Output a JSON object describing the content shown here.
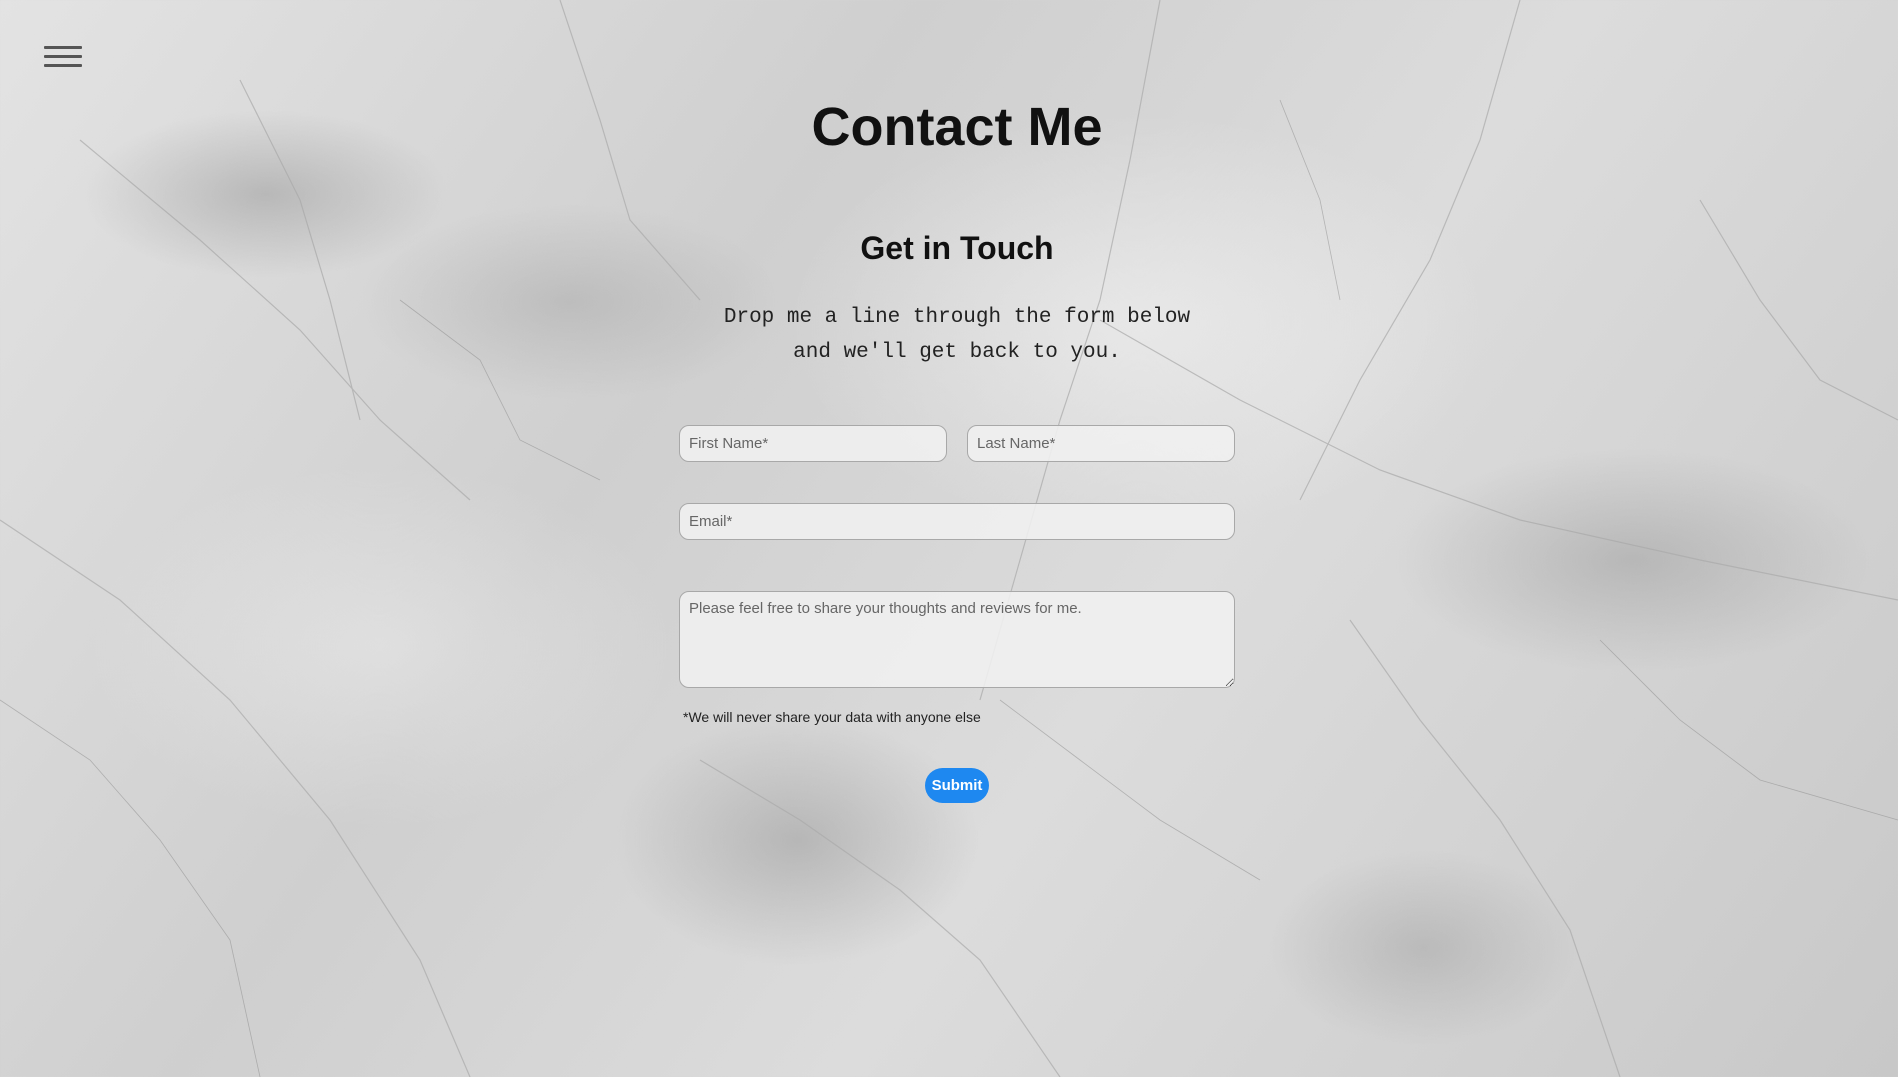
{
  "header": {
    "menu_icon": "hamburger-menu-icon"
  },
  "main": {
    "title": "Contact Me",
    "subtitle": "Get in Touch",
    "intro_line1": "Drop me a line through the form below",
    "intro_line2": "and we'll get back to you."
  },
  "form": {
    "first_name_placeholder": "First Name*",
    "first_name_value": "",
    "last_name_placeholder": "Last Name*",
    "last_name_value": "",
    "email_placeholder": "Email*",
    "email_value": "",
    "message_placeholder": "Please feel free to share your thoughts and reviews for me.",
    "message_value": "",
    "privacy_note": "*We will never share your data with anyone else",
    "submit_label": "Submit"
  },
  "colors": {
    "accent": "#1e88f0",
    "text": "#111111"
  }
}
